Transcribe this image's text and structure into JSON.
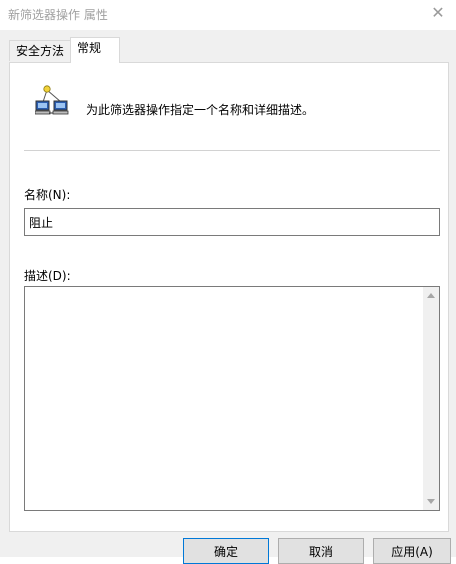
{
  "window": {
    "title": "新筛选器操作 属性",
    "close_glyph": "✕"
  },
  "tabs": [
    {
      "label": "安全方法",
      "active": false
    },
    {
      "label": "常规",
      "active": true
    }
  ],
  "general": {
    "description_text": "为此筛选器操作指定一个名称和详细描述。",
    "icon": "network-computers-icon",
    "name_label": "名称(N):",
    "name_value": "阻止",
    "desc_label": "描述(D):",
    "desc_value": ""
  },
  "buttons": {
    "ok": "确定",
    "cancel": "取消",
    "apply": "应用(A)"
  },
  "colors": {
    "accent": "#0078d7",
    "dialog_bg": "#f0f0f0",
    "title_text": "#a0a0a0"
  }
}
